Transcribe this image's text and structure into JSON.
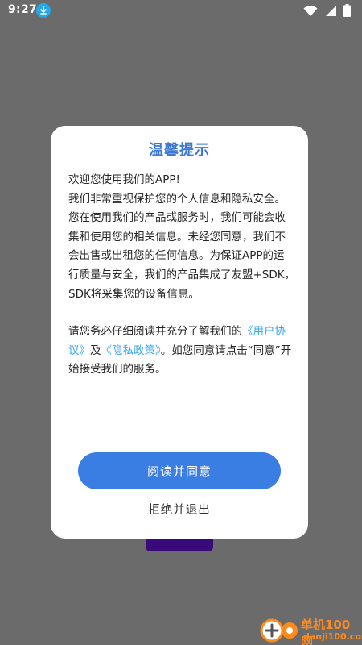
{
  "status_bar": {
    "time": "9:27",
    "download_icon": "download-icon",
    "icons": [
      "wifi-icon",
      "signal-icon",
      "battery-icon"
    ]
  },
  "dialog": {
    "title": "温馨提示",
    "lines": [
      "欢迎您使用我们的APP!",
      "我们非常重视保护您的个人信息和隐私安全。",
      "您在使用我们的产品或服务时，我们可能会收",
      "集和使用您的相关信息。未经您同意，我们不",
      "会出售或出租您的任何信息。为保证APP的运",
      "行质量与安全，我们的产品集成了友盟+SDK，",
      "SDK将采集您的设备信息。"
    ],
    "notice": {
      "pre": "请您务必仔细阅读并充分了解我们的",
      "user_agreement": "《用户协议》",
      "and": "及",
      "privacy_policy": "《隐私政策》",
      "post": "。如您同意请点击“同意”开始接受我们的服务。"
    },
    "agree_button": "阅读并同意",
    "refuse_button": "拒绝并退出"
  },
  "watermark": {
    "name": "单机100网",
    "domain": "danji100.com"
  },
  "colors": {
    "overlay": "#6b6b6b",
    "title": "#3e78d6",
    "link": "#34a6ee",
    "button": "#3b7ee3",
    "underlay_button": "#3b0a7a",
    "watermark": "#ff8a1c"
  }
}
